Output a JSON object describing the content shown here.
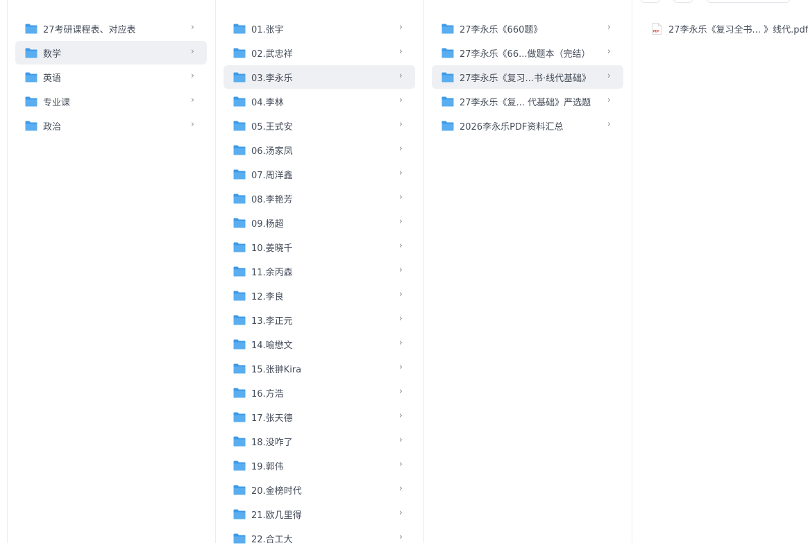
{
  "columns": [
    {
      "items": [
        {
          "label": "27考研课程表、对应表",
          "selected": false
        },
        {
          "label": "数学",
          "selected": true
        },
        {
          "label": "英语",
          "selected": false
        },
        {
          "label": "专业课",
          "selected": false
        },
        {
          "label": "政治",
          "selected": false
        }
      ]
    },
    {
      "items": [
        {
          "label": "01.张宇",
          "selected": false
        },
        {
          "label": "02.武忠祥",
          "selected": false
        },
        {
          "label": "03.李永乐",
          "selected": true
        },
        {
          "label": "04.李林",
          "selected": false
        },
        {
          "label": "05.王式安",
          "selected": false
        },
        {
          "label": "06.汤家凤",
          "selected": false
        },
        {
          "label": "07.周洋鑫",
          "selected": false
        },
        {
          "label": "08.李艳芳",
          "selected": false
        },
        {
          "label": "09.杨超",
          "selected": false
        },
        {
          "label": "10.姜晓千",
          "selected": false
        },
        {
          "label": "11.余丙森",
          "selected": false
        },
        {
          "label": "12.李良",
          "selected": false
        },
        {
          "label": "13.李正元",
          "selected": false
        },
        {
          "label": "14.喻懋文",
          "selected": false
        },
        {
          "label": "15.张翀Kira",
          "selected": false
        },
        {
          "label": "16.方浩",
          "selected": false
        },
        {
          "label": "17.张天德",
          "selected": false
        },
        {
          "label": "18.没咋了",
          "selected": false
        },
        {
          "label": "19.郭伟",
          "selected": false
        },
        {
          "label": "20.金榜时代",
          "selected": false
        },
        {
          "label": "21.欧几里得",
          "selected": false
        },
        {
          "label": "22.合工大",
          "selected": false
        }
      ]
    },
    {
      "items": [
        {
          "label": "27李永乐《660题》",
          "selected": false
        },
        {
          "label": "27李永乐《66...做题本（完结）",
          "selected": false
        },
        {
          "label": "27李永乐《复习...书·线代基础》",
          "selected": true
        },
        {
          "label": "27李永乐《复... 代基础》严选题",
          "selected": false
        },
        {
          "label": "2026李永乐PDF资料汇总",
          "selected": false
        }
      ]
    }
  ],
  "files": [
    {
      "label": "27李永乐《复习全书...  》线代.pdf",
      "icon": "pdf-file-icon",
      "icon_text": "PDF"
    }
  ],
  "icons": {
    "folder": "folder-icon",
    "chevron": "chevron-right-icon",
    "chevron_glyph": "›"
  },
  "colors": {
    "folder": "#5aaef0",
    "folder_back": "#3d9ae8",
    "selected_bg": "#eff0f3",
    "pdf": "#e5483a"
  }
}
